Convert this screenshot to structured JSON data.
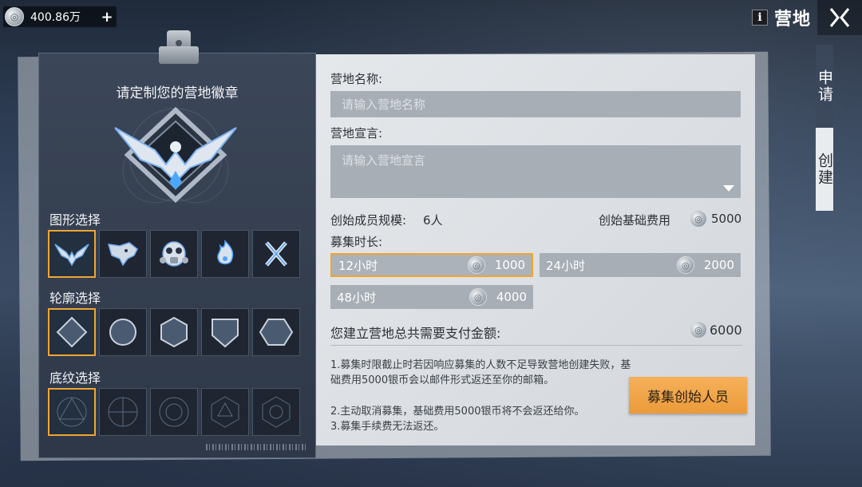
{
  "currency": {
    "amount": "400.86万",
    "plus": "+",
    "icon": "silver-coin-icon"
  },
  "header": {
    "info": "i",
    "title": "营地",
    "close_icon": "close-icon"
  },
  "side_tabs": [
    {
      "label": "申请",
      "active": false
    },
    {
      "label": "创建",
      "active": true
    }
  ],
  "left": {
    "title": "请定制您的营地徽章",
    "shape_label": "图形选择",
    "outline_label": "轮廓选择",
    "pattern_label": "底纹选择",
    "shapes": [
      "eagle-icon",
      "wolf-icon",
      "gasmask-icon",
      "flame-icon",
      "cross-blades-icon"
    ],
    "outlines": [
      "diamond-outline-icon",
      "circle-outline-icon",
      "hexagon-outline-icon",
      "shield-outline-icon",
      "wide-hexagon-outline-icon"
    ],
    "patterns": [
      "pattern-1-icon",
      "pattern-2-icon",
      "pattern-3-icon",
      "pattern-4-icon",
      "pattern-5-icon"
    ]
  },
  "form": {
    "name_label": "营地名称:",
    "name_placeholder": "请输入营地名称",
    "slogan_label": "营地宣言:",
    "slogan_placeholder": "请输入营地宣言",
    "founding_size_label": "创始成员规模:",
    "founding_size_value": "6人",
    "base_fee_label": "创始基础费用",
    "base_fee_value": "5000",
    "duration_label": "募集时长:",
    "durations": [
      {
        "label": "12小时",
        "price": "1000",
        "selected": true
      },
      {
        "label": "24小时",
        "price": "2000",
        "selected": false
      },
      {
        "label": "48小时",
        "price": "4000",
        "selected": false
      }
    ],
    "total_label": "您建立营地总共需要支付金额:",
    "total_value": "6000",
    "notes": [
      "1.募集时限截止时若因响应募集的人数不足导致营地创建失败，基础费用5000银币会以邮件形式返还至你的邮箱。",
      "2.主动取消募集，基础费用5000银币将不会返还给你。",
      "3.募集手续费无法返还。"
    ],
    "recruit_button": "募集创始人员"
  },
  "colors": {
    "accent": "#f0a530",
    "button": "#ec9a3a",
    "panel_dark": "#2e3848",
    "panel_light": "#dfe2e6"
  }
}
